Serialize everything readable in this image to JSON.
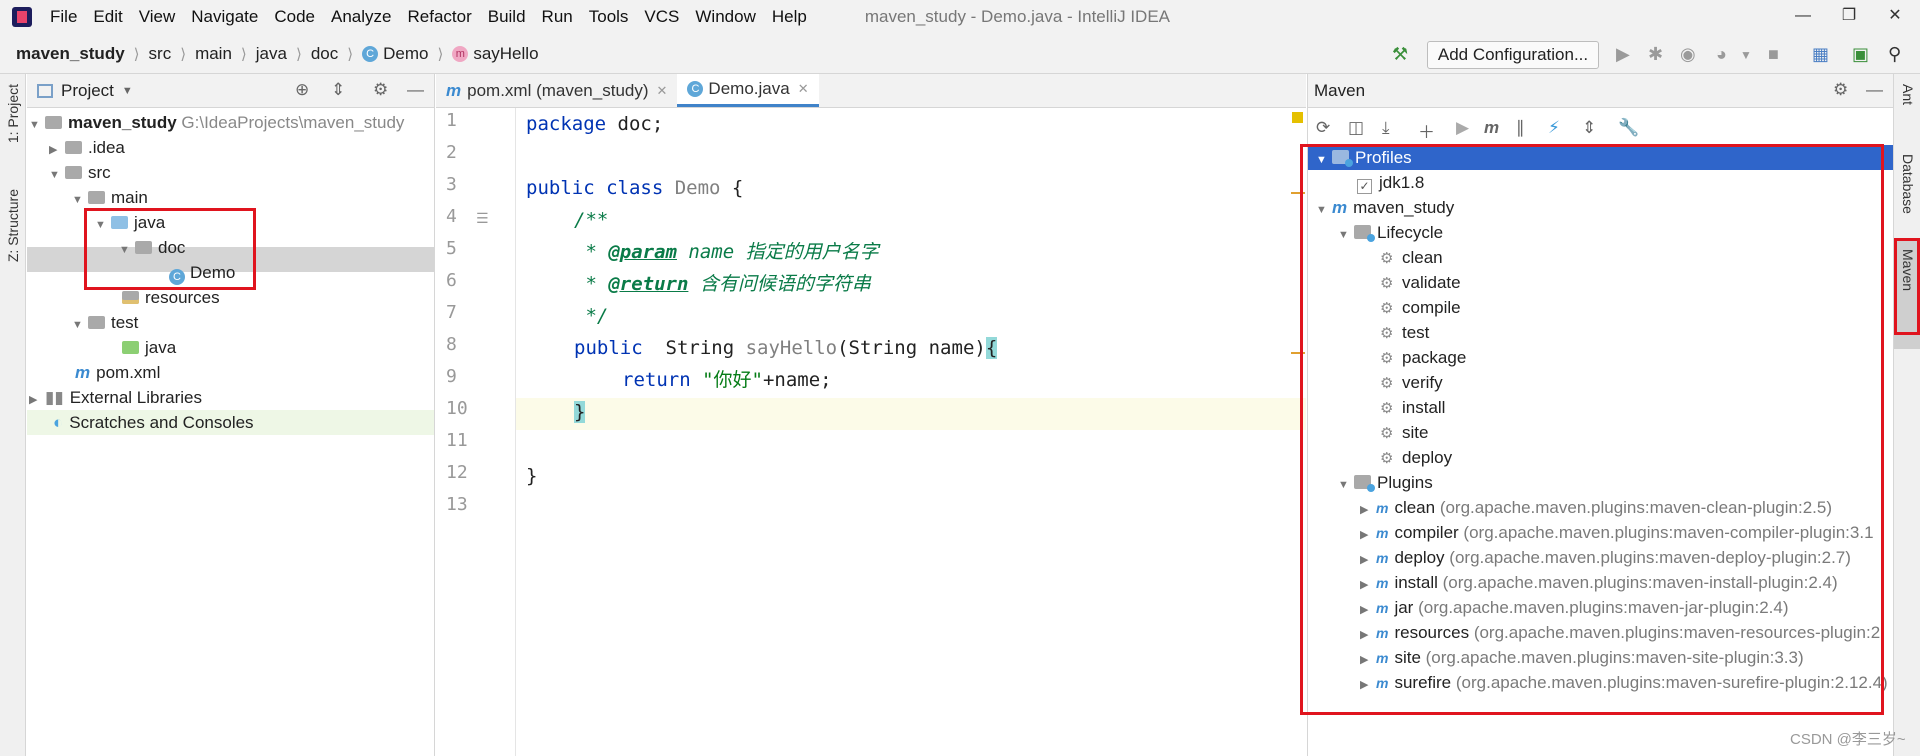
{
  "menubar": {
    "items": [
      "File",
      "Edit",
      "View",
      "Navigate",
      "Code",
      "Analyze",
      "Refactor",
      "Build",
      "Run",
      "Tools",
      "VCS",
      "Window",
      "Help"
    ],
    "title": "maven_study - Demo.java - IntelliJ IDEA"
  },
  "navbar": {
    "crumbs": [
      "maven_study",
      "src",
      "main",
      "java",
      "doc",
      "Demo",
      "sayHello"
    ],
    "add_configuration": "Add Configuration..."
  },
  "left_strip": {
    "project_tab": "1: Project",
    "structure_tab": "Z: Structure"
  },
  "project": {
    "title": "Project",
    "tree": [
      {
        "label": "maven_study",
        "path": "G:\\IdeaProjects\\maven_study"
      },
      {
        "label": ".idea"
      },
      {
        "label": "src"
      },
      {
        "label": "main"
      },
      {
        "label": "java"
      },
      {
        "label": "doc"
      },
      {
        "label": "Demo"
      },
      {
        "label": "resources"
      },
      {
        "label": "test"
      },
      {
        "label": "java"
      },
      {
        "label": "pom.xml"
      },
      {
        "label": "External Libraries"
      },
      {
        "label": "Scratches and Consoles"
      }
    ]
  },
  "editor": {
    "tabs": [
      "pom.xml (maven_study)",
      "Demo.java"
    ],
    "line_numbers": [
      "1",
      "2",
      "3",
      "4",
      "5",
      "6",
      "7",
      "8",
      "9",
      "10",
      "11",
      "12",
      "13"
    ],
    "code": {
      "l1_kw": "package",
      "l1_rest": " doc;",
      "l3_kw1": "public",
      "l3_kw2": " class",
      "l3_cls": " Demo",
      "l3_rest": " {",
      "l4": "/**",
      "l5_star": " * ",
      "l5_tag": "@param",
      "l5_rest": " name 指定的用户名字",
      "l6_star": " * ",
      "l6_tag": "@return",
      "l6_rest": " 含有问候语的字符串",
      "l7": " */",
      "l8_kw": "public",
      "l8_type": "  String ",
      "l8_fn": "sayHello",
      "l8_args": "(String name)",
      "l8_brace": "{",
      "l9_kw": "return",
      "l9_sp": " ",
      "l9_str": "\"你好\"",
      "l9_rest": "+name;",
      "l10_brace": "}",
      "l12": "}"
    }
  },
  "maven": {
    "title": "Maven",
    "profiles_label": "Profiles",
    "profile_jdk": "jdk1.8",
    "project": "maven_study",
    "lifecycle_label": "Lifecycle",
    "lifecycle": [
      "clean",
      "validate",
      "compile",
      "test",
      "package",
      "verify",
      "install",
      "site",
      "deploy"
    ],
    "plugins_label": "Plugins",
    "plugins": [
      {
        "name": "clean",
        "coord": " (org.apache.maven.plugins:maven-clean-plugin:2.5)"
      },
      {
        "name": "compiler",
        "coord": " (org.apache.maven.plugins:maven-compiler-plugin:3.1"
      },
      {
        "name": "deploy",
        "coord": " (org.apache.maven.plugins:maven-deploy-plugin:2.7)"
      },
      {
        "name": "install",
        "coord": " (org.apache.maven.plugins:maven-install-plugin:2.4)"
      },
      {
        "name": "jar",
        "coord": " (org.apache.maven.plugins:maven-jar-plugin:2.4)"
      },
      {
        "name": "resources",
        "coord": " (org.apache.maven.plugins:maven-resources-plugin:2."
      },
      {
        "name": "site",
        "coord": " (org.apache.maven.plugins:maven-site-plugin:3.3)"
      },
      {
        "name": "surefire",
        "coord": " (org.apache.maven.plugins:maven-surefire-plugin:2.12.4)"
      }
    ]
  },
  "right_strip": {
    "ant": "Ant",
    "database": "Database",
    "maven": "Maven"
  },
  "watermark": "CSDN @李三岁~",
  "colors": {
    "highlight": "#2f65ca",
    "annotation_red": "#e0141e"
  }
}
